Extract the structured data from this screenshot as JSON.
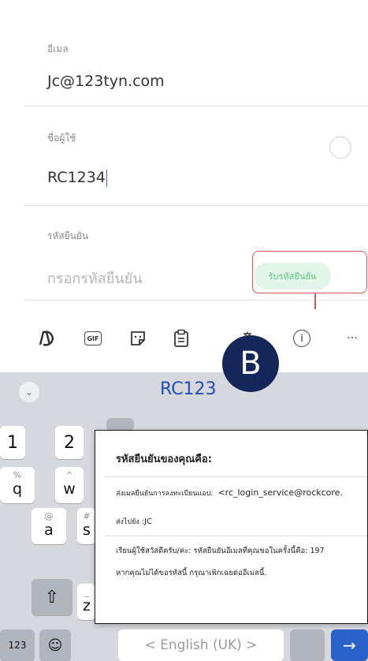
{
  "form": {
    "email_label": "อีเมล",
    "email_value": "Jc@123tyn.com",
    "username_label": "ชื่อผู้ใช้",
    "username_value": "RC1234",
    "code_label": "รหัสยืนยัน",
    "code_placeholder": "กรอกรหัสยืนยัน",
    "get_code_button": "รับรหัสยืนยัน"
  },
  "toolbar": {
    "icons": [
      "copilot-icon",
      "gif-icon",
      "sticker-icon",
      "clipboard-icon",
      "translate-icon",
      "info-icon",
      "more-icon"
    ],
    "more_label": "···",
    "info_label": "i",
    "gif_label": "GIF"
  },
  "keyboard": {
    "suggestion": "RC123",
    "collapse_label": "⌄",
    "keys_row1": [
      "1",
      "2"
    ],
    "keys_row2": [
      {
        "main": "q",
        "sub": "%"
      },
      {
        "main": "w",
        "sub": "^"
      }
    ],
    "keys_row3": [
      {
        "main": "a",
        "sub": "@"
      },
      {
        "main": "s",
        "sub": "#"
      }
    ],
    "keys_row4": [
      {
        "main": "z",
        "sub": "_"
      }
    ],
    "shift_label": "⇧",
    "num_label": "123",
    "emoji_label": "☺",
    "space_label": "< English (UK) >",
    "enter_label": "→"
  },
  "badge": "B",
  "popup": {
    "title": "รหัสยืนยันของคุณคือ:",
    "sender_label": "ส่งเมลยืนยันการลงทะเบียนแอป:",
    "sender_value": "<rc_login_service@rockcore.",
    "to_label": "ส่งไปยัง",
    "to_value": ":JC",
    "body_line1": "เรียนผู้ใช้สวัสดีครับ/ค่ะ: รหัสยืนยันอีเมลที่คุณขอในครั้งนี้คือ: 197",
    "body_line2": "หากคุณไม่ได้ขอรหัสนี้ กรุณาเพิกเฉยต่ออีเมลนี้."
  },
  "colors": {
    "accent_blue": "#1f4fb7",
    "green_button_bg": "#e2f5e9",
    "green_button_text": "#5fc185",
    "annotation_red": "#e0554d",
    "badge_navy": "#15275a"
  }
}
